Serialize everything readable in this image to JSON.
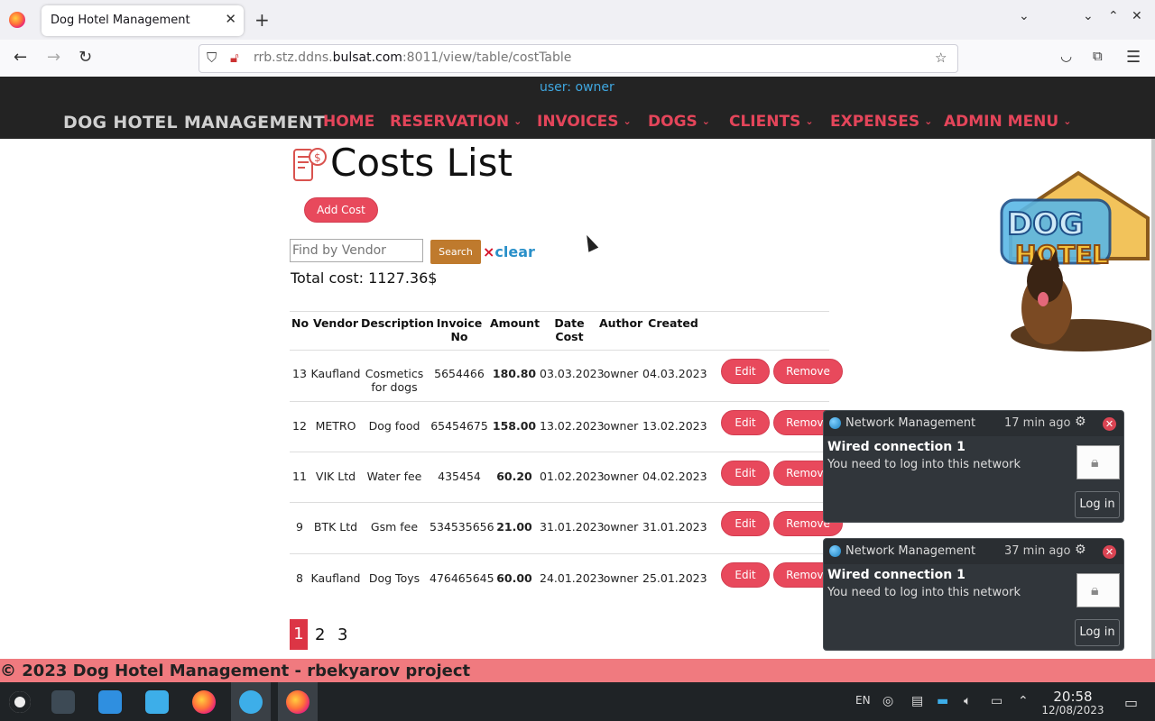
{
  "browser": {
    "tab_title": "Dog Hotel Management",
    "tab_close": "✕",
    "new_tab": "+",
    "url_host_pre": "rrb.stz.ddns.",
    "url_host_main": "bulsat.com",
    "url_rest": ":8011/view/table/costTable"
  },
  "site": {
    "user_line": "user: owner",
    "brand": "DOG HOTEL MANAGEMENT",
    "menu": [
      {
        "label": "HOME",
        "dropdown": false
      },
      {
        "label": "RESERVATION",
        "dropdown": true
      },
      {
        "label": "INVOICES",
        "dropdown": true
      },
      {
        "label": "DOGS",
        "dropdown": true
      },
      {
        "label": "CLIENTS",
        "dropdown": true
      },
      {
        "label": "EXPENSES",
        "dropdown": true
      },
      {
        "label": "ADMIN MENU",
        "dropdown": true
      }
    ],
    "menu_chevron": "⌄"
  },
  "page": {
    "title": "Costs List",
    "add_button": "Add Cost",
    "search_placeholder": "Find by Vendor",
    "search_button": "Search",
    "clear_x": "×",
    "clear_label": "clear",
    "total": "Total cost: 1127.36$"
  },
  "table": {
    "headers": [
      "No",
      "Vendor",
      "Description",
      "Invoice No",
      "Amount",
      "Date Cost",
      "Author",
      "Created"
    ],
    "header_invoice_1": "Invoice",
    "header_invoice_2": "No",
    "edit_label": "Edit",
    "remove_label": "Remove",
    "rows": [
      {
        "no": "13",
        "vendor": "Kaufland",
        "description_1": "Cosmetics",
        "description_2": "for dogs",
        "invoice": "5654466",
        "amount": "180.80",
        "date": "03.03.2023",
        "author": "owner",
        "created": "04.03.2023"
      },
      {
        "no": "12",
        "vendor": "METRO",
        "description_1": "Dog food",
        "description_2": "",
        "invoice": "65454675",
        "amount": "158.00",
        "date": "13.02.2023",
        "author": "owner",
        "created": "13.02.2023"
      },
      {
        "no": "11",
        "vendor": "VIK Ltd",
        "description_1": "Water fee",
        "description_2": "",
        "invoice": "435454",
        "amount": "60.20",
        "date": "01.02.2023",
        "author": "owner",
        "created": "04.02.2023"
      },
      {
        "no": "9",
        "vendor": "BTK Ltd",
        "description_1": "Gsm fee",
        "description_2": "",
        "invoice": "534535656",
        "amount": "21.00",
        "date": "31.01.2023",
        "author": "owner",
        "created": "31.01.2023"
      },
      {
        "no": "8",
        "vendor": "Kaufland",
        "description_1": "Dog Toys",
        "description_2": "",
        "invoice": "476465645",
        "amount": "60.00",
        "date": "24.01.2023",
        "author": "owner",
        "created": "25.01.2023"
      }
    ]
  },
  "pagination": {
    "pages": [
      "1",
      "2",
      "3"
    ],
    "active": "1"
  },
  "footer": "© 2023 Dog Hotel Management - rbekyarov project",
  "logo": {
    "word1": "DOG",
    "word2": "HOTEL"
  },
  "notifications": [
    {
      "app": "Network Management",
      "time": "17 min ago",
      "title": "Wired connection 1",
      "body": "You need to log into this network",
      "action": "Log in"
    },
    {
      "app": "Network Management",
      "time": "37 min ago",
      "title": "Wired connection 1",
      "body": "You need to log into this network",
      "action": "Log in"
    }
  ],
  "taskbar": {
    "lang": "EN",
    "time": "20:58",
    "date": "12/08/2023"
  },
  "colors": {
    "accent_red": "#e8495c",
    "header_bg": "#232323",
    "footer_bg": "#f07a7f",
    "search_btn": "#bf7a2d",
    "link_blue": "#2a90c9"
  }
}
